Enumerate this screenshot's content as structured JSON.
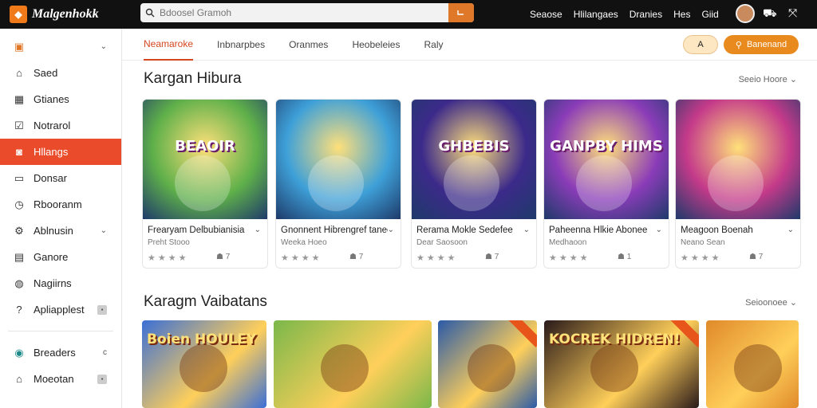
{
  "app": {
    "logo_text": "Malgenhokk"
  },
  "search": {
    "placeholder": "Bdoosel Gramoh"
  },
  "topnav": [
    "Seaose",
    "Hlilangaes",
    "Dranies",
    "Hes",
    "Giid"
  ],
  "sidebar": {
    "items": [
      {
        "label": "",
        "icon": "box-icon",
        "chevron": true
      },
      {
        "label": "Saed",
        "icon": "home-icon"
      },
      {
        "label": "Gtianes",
        "icon": "grid-icon"
      },
      {
        "label": "Notrarol",
        "icon": "check-square-icon"
      },
      {
        "label": "Hllangs",
        "icon": "camera-icon",
        "active": true
      },
      {
        "label": "Donsar",
        "icon": "document-icon"
      },
      {
        "label": "Rbooranm",
        "icon": "clock-icon"
      },
      {
        "label": "Ablnusin",
        "icon": "settings-icon",
        "chevron": true
      },
      {
        "label": "Ganore",
        "icon": "puzzle-icon"
      },
      {
        "label": "Nagiirns",
        "icon": "globe-icon"
      },
      {
        "label": "Apliapplest",
        "icon": "help-icon",
        "badge": true
      }
    ],
    "bottom": [
      {
        "label": "Breaders",
        "icon": "globe-blue-icon",
        "mark": "c"
      },
      {
        "label": "Moeotan",
        "icon": "house-icon",
        "badge": true
      }
    ]
  },
  "tabs": [
    "Neamaroke",
    "Inbnarpbes",
    "Oranmes",
    "Heobeleies",
    "Raly"
  ],
  "header_buttons": {
    "small_label": "A",
    "primary_label": "Banenand"
  },
  "section1": {
    "title": "Kargan Hibura",
    "more": "Seeio Hoore",
    "cards": [
      {
        "thumb_text": "BEAOIR",
        "title": "Frearyam Delbubianisia",
        "sub": "Preht Stooo",
        "count": "7",
        "bg": "#5fb04a"
      },
      {
        "thumb_text": "",
        "title": "Gnonnent Hibrengref tanee",
        "sub": "Weeka Hoeo",
        "count": "7",
        "bg": "#3ea0d8"
      },
      {
        "thumb_text": "GHBEBIS",
        "title": "Rerama Mokle Sedefee",
        "sub": "Dear Saosoon",
        "count": "7",
        "bg": "#3c2a8a"
      },
      {
        "thumb_text": "GANPBY HIMS",
        "title": "Paheenna Hlkie Abonee",
        "sub": "Medhaoon",
        "count": "1",
        "bg": "#8a3cb8"
      },
      {
        "thumb_text": "",
        "title": "Meagoon Boenah",
        "sub": "Neano Sean",
        "count": "7",
        "bg": "#c43a8a"
      }
    ]
  },
  "section2": {
    "title": "Karagm Vaibatans",
    "more": "Seioonoee",
    "cards": [
      {
        "thumb_text": "Boien HOULEY",
        "bg": "#3b6fd6"
      },
      {
        "thumb_text": "",
        "bg": "#7ab84a"
      },
      {
        "thumb_text": "",
        "bg": "#2a5aa8"
      },
      {
        "thumb_text": "KOCREK HIDREN!",
        "bg": "#2a1a1a"
      },
      {
        "thumb_text": "",
        "bg": "#e08a2a"
      }
    ]
  }
}
